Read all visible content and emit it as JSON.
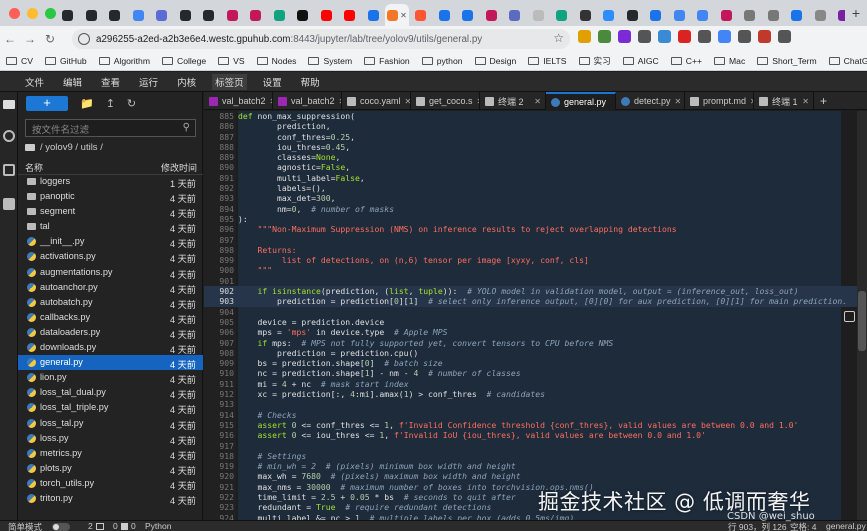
{
  "browser": {
    "tabs": [
      {
        "favicon": "github-icon",
        "color": "#24292e",
        "close": false
      },
      {
        "favicon": "github-icon",
        "color": "#24292e",
        "close": false
      },
      {
        "favicon": "github-icon",
        "color": "#24292e",
        "close": false
      },
      {
        "favicon": "chrome-icon",
        "color": "#4285f4",
        "close": false
      },
      {
        "favicon": "doc-icon",
        "color": "#5b6bd6",
        "close": false
      },
      {
        "favicon": "github-icon",
        "color": "#24292e",
        "close": false
      },
      {
        "favicon": "github-icon",
        "color": "#24292e",
        "close": false
      },
      {
        "favicon": "play-icon",
        "color": "#c2185b",
        "close": false
      },
      {
        "favicon": "bars-icon",
        "color": "#c2185b",
        "close": false
      },
      {
        "favicon": "openai-icon",
        "color": "#10a37f",
        "close": false
      },
      {
        "favicon": "dev-icon",
        "color": "#111111",
        "close": false
      },
      {
        "favicon": "youtube-icon",
        "color": "#ff0000",
        "close": false
      },
      {
        "favicon": "youtube-icon",
        "color": "#ff0000",
        "close": false
      },
      {
        "favicon": "shield-icon",
        "color": "#1a73e8",
        "close": false
      },
      {
        "favicon": "jupyter-icon",
        "color": "#f37726",
        "close": true
      },
      {
        "favicon": "c-icon",
        "color": "#fc5531",
        "close": false
      },
      {
        "favicon": "sync-icon",
        "color": "#1a73e8",
        "close": false
      },
      {
        "favicon": "sync-icon",
        "color": "#1a73e8",
        "close": false
      },
      {
        "favicon": "play-icon",
        "color": "#c2185b",
        "close": false
      },
      {
        "favicon": "paper-icon",
        "color": "#5c6bc0",
        "close": false
      },
      {
        "favicon": "globe-icon",
        "color": "#bbbbbb",
        "close": false
      },
      {
        "favicon": "openai-icon",
        "color": "#10a37f",
        "close": false
      },
      {
        "favicon": "monitor-icon",
        "color": "#333333",
        "close": false
      },
      {
        "favicon": "zoom-icon",
        "color": "#2d8cff",
        "close": false
      },
      {
        "favicon": "github-icon",
        "color": "#24292e",
        "close": false
      },
      {
        "favicon": "cloud-icon",
        "color": "#1a73e8",
        "close": false
      },
      {
        "favicon": "google-icon",
        "color": "#4285f4",
        "close": false
      },
      {
        "favicon": "google-icon",
        "color": "#4285f4",
        "close": false
      },
      {
        "favicon": "play-icon",
        "color": "#c2185b",
        "close": false
      },
      {
        "favicon": "settings-icon",
        "color": "#777777",
        "close": false
      },
      {
        "favicon": "settings-icon",
        "color": "#777777",
        "close": false
      },
      {
        "favicon": "sync-icon",
        "color": "#1a73e8",
        "close": false
      },
      {
        "favicon": "reader-icon",
        "color": "#888888",
        "close": false
      },
      {
        "favicon": "flower-icon",
        "color": "#7b1fa2",
        "close": false
      }
    ],
    "active_tab_index": 14,
    "new_tab_label": "+",
    "url_host": "a296255-a2ed-a2b3e6e4.westc.gpuhub.com",
    "url_path": ":8443/jupyter/lab/tree/yolov9/utils/general.py",
    "extension_colors": [
      "#e0a000",
      "#4a8a3a",
      "#7a2ad6",
      "#555555",
      "#3a8ad6",
      "#dd2222",
      "#555555",
      "#4285f4",
      "#555555",
      "#c0392b",
      "#555555"
    ],
    "bookmarks": [
      "CV",
      "GitHub",
      "Algorithm",
      "College",
      "VS",
      "Nodes",
      "System",
      "Fashion",
      "python",
      "Design",
      "IELTS",
      "实习",
      "AIGC",
      "C++",
      "Mac",
      "Short_Term",
      "ChatGPT"
    ]
  },
  "menubar": [
    "文件",
    "编辑",
    "查看",
    "运行",
    "内核",
    "标签页",
    "设置",
    "帮助"
  ],
  "menubar_active": "标签页",
  "filebrowser": {
    "new_label": "+",
    "filter_placeholder": "按文件名过滤",
    "breadcrumb": "/ yolov9 / utils /",
    "col_name": "名称",
    "col_modified": "修改时间",
    "files": [
      {
        "name": "loggers",
        "modified": "1 天前",
        "type": "dir"
      },
      {
        "name": "panoptic",
        "modified": "4 天前",
        "type": "dir"
      },
      {
        "name": "segment",
        "modified": "4 天前",
        "type": "dir"
      },
      {
        "name": "tal",
        "modified": "4 天前",
        "type": "dir"
      },
      {
        "name": "__init__.py",
        "modified": "4 天前",
        "type": "py"
      },
      {
        "name": "activations.py",
        "modified": "4 天前",
        "type": "py"
      },
      {
        "name": "augmentations.py",
        "modified": "4 天前",
        "type": "py"
      },
      {
        "name": "autoanchor.py",
        "modified": "4 天前",
        "type": "py"
      },
      {
        "name": "autobatch.py",
        "modified": "4 天前",
        "type": "py"
      },
      {
        "name": "callbacks.py",
        "modified": "4 天前",
        "type": "py"
      },
      {
        "name": "dataloaders.py",
        "modified": "4 天前",
        "type": "py"
      },
      {
        "name": "downloads.py",
        "modified": "4 天前",
        "type": "py"
      },
      {
        "name": "general.py",
        "modified": "4 天前",
        "type": "py",
        "selected": true
      },
      {
        "name": "lion.py",
        "modified": "4 天前",
        "type": "py"
      },
      {
        "name": "loss_tal_dual.py",
        "modified": "4 天前",
        "type": "py"
      },
      {
        "name": "loss_tal_triple.py",
        "modified": "4 天前",
        "type": "py"
      },
      {
        "name": "loss_tal.py",
        "modified": "4 天前",
        "type": "py"
      },
      {
        "name": "loss.py",
        "modified": "4 天前",
        "type": "py"
      },
      {
        "name": "metrics.py",
        "modified": "4 天前",
        "type": "py"
      },
      {
        "name": "plots.py",
        "modified": "4 天前",
        "type": "py"
      },
      {
        "name": "torch_utils.py",
        "modified": "4 天前",
        "type": "py"
      },
      {
        "name": "triton.py",
        "modified": "4 天前",
        "type": "py"
      }
    ]
  },
  "editor_tabs": [
    {
      "label": "val_batch2",
      "icon": "image-icon",
      "icon_color": "#9c27b0",
      "width": 69
    },
    {
      "label": "val_batch2",
      "icon": "image-icon",
      "icon_color": "#9c27b0",
      "width": 69
    },
    {
      "label": "coco.yaml",
      "icon": "file-icon",
      "icon_color": "#bbbbbb",
      "width": 69
    },
    {
      "label": "get_coco.s",
      "icon": "file-icon",
      "icon_color": "#bbbbbb",
      "width": 69
    },
    {
      "label": "终端 2",
      "icon": "terminal-icon",
      "icon_color": "#bbbbbb",
      "width": 66
    },
    {
      "label": "general.py",
      "icon": "python-icon",
      "icon_color": "#3e7ab8",
      "width": 70,
      "active": true
    },
    {
      "label": "detect.py",
      "icon": "python-icon",
      "icon_color": "#3e7ab8",
      "width": 69
    },
    {
      "label": "prompt.md",
      "icon": "markdown-icon",
      "icon_color": "#bbbbbb",
      "width": 69
    },
    {
      "label": "终端 1",
      "icon": "terminal-icon",
      "icon_color": "#bbbbbb",
      "width": 60
    }
  ],
  "code_lines": [
    {
      "n": "885",
      "t": [
        [
          "def ",
          "kw"
        ],
        [
          "non_max_suppression(",
          ""
        ]
      ]
    },
    {
      "n": "886",
      "t": [
        [
          "        prediction,",
          ""
        ]
      ]
    },
    {
      "n": "887",
      "t": [
        [
          "        conf_thres=",
          ""
        ],
        [
          "0.25",
          "num"
        ],
        [
          ",",
          ""
        ]
      ]
    },
    {
      "n": "888",
      "t": [
        [
          "        iou_thres=",
          ""
        ],
        [
          "0.45",
          "num"
        ],
        [
          ",",
          ""
        ]
      ]
    },
    {
      "n": "889",
      "t": [
        [
          "        classes=",
          ""
        ],
        [
          "None",
          "kw"
        ],
        [
          ",",
          ""
        ]
      ]
    },
    {
      "n": "890",
      "t": [
        [
          "        agnostic=",
          ""
        ],
        [
          "False",
          "kw"
        ],
        [
          ",",
          ""
        ]
      ]
    },
    {
      "n": "891",
      "t": [
        [
          "        multi_label=",
          ""
        ],
        [
          "False",
          "kw"
        ],
        [
          ",",
          ""
        ]
      ]
    },
    {
      "n": "892",
      "t": [
        [
          "        labels=(),",
          ""
        ]
      ]
    },
    {
      "n": "893",
      "t": [
        [
          "        max_det=",
          ""
        ],
        [
          "300",
          "num"
        ],
        [
          ",",
          ""
        ]
      ]
    },
    {
      "n": "894",
      "t": [
        [
          "        nm=",
          ""
        ],
        [
          "0",
          "num"
        ],
        [
          ",  ",
          ""
        ],
        [
          "# number of masks",
          "cmt"
        ]
      ]
    },
    {
      "n": "895",
      "t": [
        [
          "):",
          ""
        ]
      ]
    },
    {
      "n": "896",
      "t": [
        [
          "    ",
          ""
        ],
        [
          "\"\"\"Non-Maximum Suppression (NMS) on inference results to reject overlapping detections",
          "str"
        ]
      ]
    },
    {
      "n": "897",
      "t": [
        [
          "",
          ""
        ]
      ]
    },
    {
      "n": "898",
      "t": [
        [
          "    ",
          ""
        ],
        [
          "Returns:",
          "str"
        ]
      ]
    },
    {
      "n": "899",
      "t": [
        [
          "         ",
          ""
        ],
        [
          "list of detections, on (n,6) tensor per image [xyxy, conf, cls]",
          "str"
        ]
      ]
    },
    {
      "n": "900",
      "t": [
        [
          "    ",
          ""
        ],
        [
          "\"\"\"",
          "str"
        ]
      ]
    },
    {
      "n": "901",
      "t": [
        [
          "",
          ""
        ]
      ]
    },
    {
      "n": "902",
      "t": [
        [
          "    ",
          ""
        ],
        [
          "if ",
          "kw"
        ],
        [
          "isinstance",
          "kw"
        ],
        [
          "(prediction, (",
          ""
        ],
        [
          "list",
          "kw"
        ],
        [
          ", ",
          ""
        ],
        [
          "tuple",
          "kw"
        ],
        [
          ")):  ",
          ""
        ],
        [
          "# YOLO model in validation model, output = (inference_out, loss_out)",
          "cmt"
        ]
      ],
      "hl": true
    },
    {
      "n": "903",
      "t": [
        [
          "        prediction = prediction[",
          ""
        ],
        [
          "0",
          "num"
        ],
        [
          "][",
          ""
        ],
        [
          "1",
          "num"
        ],
        [
          "]  ",
          ""
        ],
        [
          "# select only inference output, [0][0] for aux prediction, [0][1] for main prediction.",
          "cmt"
        ]
      ],
      "hl": true
    },
    {
      "n": "904",
      "t": [
        [
          "",
          ""
        ]
      ]
    },
    {
      "n": "905",
      "t": [
        [
          "    device = prediction.device",
          ""
        ]
      ]
    },
    {
      "n": "906",
      "t": [
        [
          "    mps = ",
          ""
        ],
        [
          "'mps'",
          "str"
        ],
        [
          " in device.type  ",
          ""
        ],
        [
          "# Apple MPS",
          "cmt"
        ]
      ]
    },
    {
      "n": "907",
      "t": [
        [
          "    ",
          ""
        ],
        [
          "if ",
          "kw"
        ],
        [
          "mps:  ",
          ""
        ],
        [
          "# MPS not fully supported yet, convert tensors to CPU before NMS",
          "cmt"
        ]
      ]
    },
    {
      "n": "908",
      "t": [
        [
          "        prediction = prediction.cpu()",
          ""
        ]
      ]
    },
    {
      "n": "909",
      "t": [
        [
          "    bs = prediction.shape[",
          ""
        ],
        [
          "0",
          "num"
        ],
        [
          "]  ",
          ""
        ],
        [
          "# batch size",
          "cmt"
        ]
      ]
    },
    {
      "n": "910",
      "t": [
        [
          "    nc = prediction.shape[",
          ""
        ],
        [
          "1",
          "num"
        ],
        [
          "] - nm - ",
          ""
        ],
        [
          "4",
          "num"
        ],
        [
          "  ",
          ""
        ],
        [
          "# number of classes",
          "cmt"
        ]
      ]
    },
    {
      "n": "911",
      "t": [
        [
          "    mi = ",
          ""
        ],
        [
          "4",
          "num"
        ],
        [
          " + nc  ",
          ""
        ],
        [
          "# mask start index",
          "cmt"
        ]
      ]
    },
    {
      "n": "912",
      "t": [
        [
          "    xc = prediction[:, ",
          ""
        ],
        [
          "4",
          "num"
        ],
        [
          ":mi].amax(",
          ""
        ],
        [
          "1",
          "num"
        ],
        [
          ") > conf_thres  ",
          ""
        ],
        [
          "# candidates",
          "cmt"
        ]
      ]
    },
    {
      "n": "913",
      "t": [
        [
          "",
          ""
        ]
      ]
    },
    {
      "n": "914",
      "t": [
        [
          "    ",
          ""
        ],
        [
          "# Checks",
          "cmt"
        ]
      ]
    },
    {
      "n": "915",
      "t": [
        [
          "    ",
          ""
        ],
        [
          "assert ",
          "kw"
        ],
        [
          "0",
          "num"
        ],
        [
          " <= conf_thres <= ",
          ""
        ],
        [
          "1",
          "num"
        ],
        [
          ", ",
          ""
        ],
        [
          "f'Invalid Confidence threshold {conf_thres}, valid values are between 0.0 and 1.0'",
          "str"
        ]
      ]
    },
    {
      "n": "916",
      "t": [
        [
          "    ",
          ""
        ],
        [
          "assert ",
          "kw"
        ],
        [
          "0",
          "num"
        ],
        [
          " <= iou_thres <= ",
          ""
        ],
        [
          "1",
          "num"
        ],
        [
          ", ",
          ""
        ],
        [
          "f'Invalid IoU {iou_thres}, valid values are between 0.0 and 1.0'",
          "str"
        ]
      ]
    },
    {
      "n": "917",
      "t": [
        [
          "",
          ""
        ]
      ]
    },
    {
      "n": "918",
      "t": [
        [
          "    ",
          ""
        ],
        [
          "# Settings",
          "cmt"
        ]
      ]
    },
    {
      "n": "919",
      "t": [
        [
          "    ",
          ""
        ],
        [
          "# min_wh = 2  # (pixels) minimum box width and height",
          "cmt"
        ]
      ]
    },
    {
      "n": "920",
      "t": [
        [
          "    max_wh = ",
          ""
        ],
        [
          "7680",
          "num"
        ],
        [
          "  ",
          ""
        ],
        [
          "# (pixels) maximum box width and height",
          "cmt"
        ]
      ]
    },
    {
      "n": "921",
      "t": [
        [
          "    max_nms = ",
          ""
        ],
        [
          "30000",
          "num"
        ],
        [
          "  ",
          ""
        ],
        [
          "# maximum number of boxes into torchvision.ops.nms()",
          "cmt"
        ]
      ]
    },
    {
      "n": "922",
      "t": [
        [
          "    time_limit = ",
          ""
        ],
        [
          "2.5",
          "num"
        ],
        [
          " + ",
          ""
        ],
        [
          "0.05",
          "num"
        ],
        [
          " * bs  ",
          ""
        ],
        [
          "# seconds to quit after",
          "cmt"
        ]
      ]
    },
    {
      "n": "923",
      "t": [
        [
          "    redundant = ",
          ""
        ],
        [
          "True",
          "kw"
        ],
        [
          "  ",
          ""
        ],
        [
          "# require redundant detections",
          "cmt"
        ]
      ]
    },
    {
      "n": "924",
      "t": [
        [
          "    multi_label &= nc > ",
          ""
        ],
        [
          "1",
          "num"
        ],
        [
          "  ",
          ""
        ],
        [
          "# multiple labels per box (adds 0.5ms/img)",
          "cmt"
        ]
      ]
    }
  ],
  "statusbar": {
    "mode_label": "简单模式",
    "kernel_a": "2",
    "kernel_b": "0",
    "kernel_c": "0",
    "language": "Python",
    "position": "行 903，列 126",
    "spaces": "空格: 4",
    "filename": "general.py"
  },
  "watermark": "掘金技术社区 @ 低调而奢华",
  "watermark_small": "CSDN @wei_shuo"
}
